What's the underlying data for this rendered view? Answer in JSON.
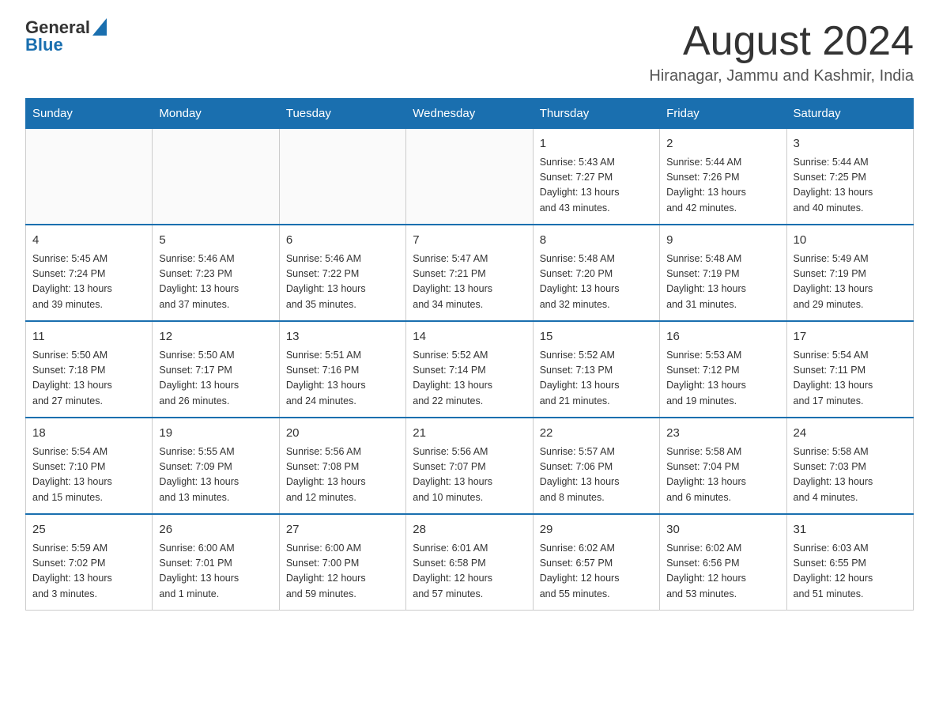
{
  "header": {
    "logo_general": "General",
    "logo_blue": "Blue",
    "month_title": "August 2024",
    "location": "Hiranagar, Jammu and Kashmir, India"
  },
  "weekdays": [
    "Sunday",
    "Monday",
    "Tuesday",
    "Wednesday",
    "Thursday",
    "Friday",
    "Saturday"
  ],
  "weeks": [
    [
      {
        "day": "",
        "info": ""
      },
      {
        "day": "",
        "info": ""
      },
      {
        "day": "",
        "info": ""
      },
      {
        "day": "",
        "info": ""
      },
      {
        "day": "1",
        "info": "Sunrise: 5:43 AM\nSunset: 7:27 PM\nDaylight: 13 hours\nand 43 minutes."
      },
      {
        "day": "2",
        "info": "Sunrise: 5:44 AM\nSunset: 7:26 PM\nDaylight: 13 hours\nand 42 minutes."
      },
      {
        "day": "3",
        "info": "Sunrise: 5:44 AM\nSunset: 7:25 PM\nDaylight: 13 hours\nand 40 minutes."
      }
    ],
    [
      {
        "day": "4",
        "info": "Sunrise: 5:45 AM\nSunset: 7:24 PM\nDaylight: 13 hours\nand 39 minutes."
      },
      {
        "day": "5",
        "info": "Sunrise: 5:46 AM\nSunset: 7:23 PM\nDaylight: 13 hours\nand 37 minutes."
      },
      {
        "day": "6",
        "info": "Sunrise: 5:46 AM\nSunset: 7:22 PM\nDaylight: 13 hours\nand 35 minutes."
      },
      {
        "day": "7",
        "info": "Sunrise: 5:47 AM\nSunset: 7:21 PM\nDaylight: 13 hours\nand 34 minutes."
      },
      {
        "day": "8",
        "info": "Sunrise: 5:48 AM\nSunset: 7:20 PM\nDaylight: 13 hours\nand 32 minutes."
      },
      {
        "day": "9",
        "info": "Sunrise: 5:48 AM\nSunset: 7:19 PM\nDaylight: 13 hours\nand 31 minutes."
      },
      {
        "day": "10",
        "info": "Sunrise: 5:49 AM\nSunset: 7:19 PM\nDaylight: 13 hours\nand 29 minutes."
      }
    ],
    [
      {
        "day": "11",
        "info": "Sunrise: 5:50 AM\nSunset: 7:18 PM\nDaylight: 13 hours\nand 27 minutes."
      },
      {
        "day": "12",
        "info": "Sunrise: 5:50 AM\nSunset: 7:17 PM\nDaylight: 13 hours\nand 26 minutes."
      },
      {
        "day": "13",
        "info": "Sunrise: 5:51 AM\nSunset: 7:16 PM\nDaylight: 13 hours\nand 24 minutes."
      },
      {
        "day": "14",
        "info": "Sunrise: 5:52 AM\nSunset: 7:14 PM\nDaylight: 13 hours\nand 22 minutes."
      },
      {
        "day": "15",
        "info": "Sunrise: 5:52 AM\nSunset: 7:13 PM\nDaylight: 13 hours\nand 21 minutes."
      },
      {
        "day": "16",
        "info": "Sunrise: 5:53 AM\nSunset: 7:12 PM\nDaylight: 13 hours\nand 19 minutes."
      },
      {
        "day": "17",
        "info": "Sunrise: 5:54 AM\nSunset: 7:11 PM\nDaylight: 13 hours\nand 17 minutes."
      }
    ],
    [
      {
        "day": "18",
        "info": "Sunrise: 5:54 AM\nSunset: 7:10 PM\nDaylight: 13 hours\nand 15 minutes."
      },
      {
        "day": "19",
        "info": "Sunrise: 5:55 AM\nSunset: 7:09 PM\nDaylight: 13 hours\nand 13 minutes."
      },
      {
        "day": "20",
        "info": "Sunrise: 5:56 AM\nSunset: 7:08 PM\nDaylight: 13 hours\nand 12 minutes."
      },
      {
        "day": "21",
        "info": "Sunrise: 5:56 AM\nSunset: 7:07 PM\nDaylight: 13 hours\nand 10 minutes."
      },
      {
        "day": "22",
        "info": "Sunrise: 5:57 AM\nSunset: 7:06 PM\nDaylight: 13 hours\nand 8 minutes."
      },
      {
        "day": "23",
        "info": "Sunrise: 5:58 AM\nSunset: 7:04 PM\nDaylight: 13 hours\nand 6 minutes."
      },
      {
        "day": "24",
        "info": "Sunrise: 5:58 AM\nSunset: 7:03 PM\nDaylight: 13 hours\nand 4 minutes."
      }
    ],
    [
      {
        "day": "25",
        "info": "Sunrise: 5:59 AM\nSunset: 7:02 PM\nDaylight: 13 hours\nand 3 minutes."
      },
      {
        "day": "26",
        "info": "Sunrise: 6:00 AM\nSunset: 7:01 PM\nDaylight: 13 hours\nand 1 minute."
      },
      {
        "day": "27",
        "info": "Sunrise: 6:00 AM\nSunset: 7:00 PM\nDaylight: 12 hours\nand 59 minutes."
      },
      {
        "day": "28",
        "info": "Sunrise: 6:01 AM\nSunset: 6:58 PM\nDaylight: 12 hours\nand 57 minutes."
      },
      {
        "day": "29",
        "info": "Sunrise: 6:02 AM\nSunset: 6:57 PM\nDaylight: 12 hours\nand 55 minutes."
      },
      {
        "day": "30",
        "info": "Sunrise: 6:02 AM\nSunset: 6:56 PM\nDaylight: 12 hours\nand 53 minutes."
      },
      {
        "day": "31",
        "info": "Sunrise: 6:03 AM\nSunset: 6:55 PM\nDaylight: 12 hours\nand 51 minutes."
      }
    ]
  ]
}
